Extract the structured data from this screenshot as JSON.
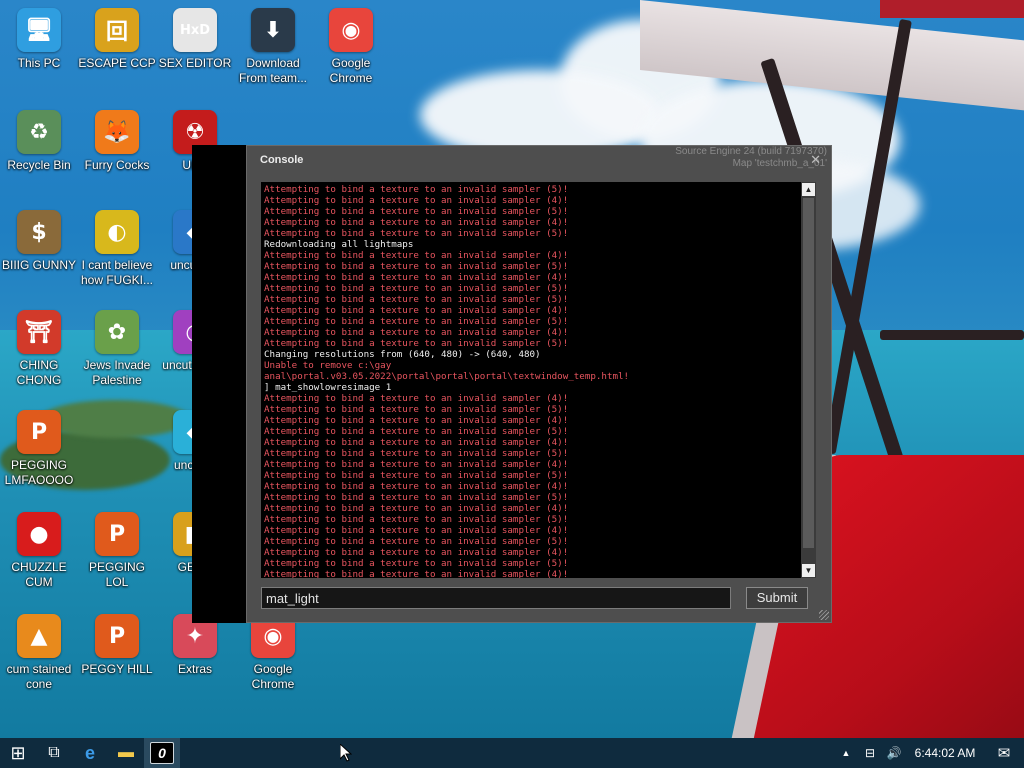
{
  "desktop": {
    "icons": [
      {
        "label": "This PC",
        "glyph": "🖥",
        "color": "#2f9ee0",
        "icon": "computer-icon"
      },
      {
        "label": "ESCAPE CCP",
        "glyph": "回",
        "color": "#d9a21c",
        "icon": "game-box-icon"
      },
      {
        "label": "SEX EDITOR",
        "glyph": "HxD",
        "color": "#e6e6e6",
        "icon": "hex-editor-icon"
      },
      {
        "label": "Download From team...",
        "glyph": "⬇",
        "color": "#2a3a4a",
        "icon": "download-icon"
      },
      {
        "label": "Google Chrome",
        "glyph": "◉",
        "color": "#e8453c",
        "icon": "chrome-icon"
      },
      {
        "label": "Recycle Bin",
        "glyph": "♻",
        "color": "#5a8f5a",
        "icon": "recycle-bin-icon"
      },
      {
        "label": "Furry Cocks",
        "glyph": "🦊",
        "color": "#f07a1a",
        "icon": "firefox-icon"
      },
      {
        "label": "UKR",
        "glyph": "☢",
        "color": "#c41c1c",
        "icon": "radiation-icon"
      },
      {
        "label": "BIIIG GUNNY",
        "glyph": "$",
        "color": "#8a6a3a",
        "icon": "money-bag-icon"
      },
      {
        "label": "I cant believe how FUGKI...",
        "glyph": "◐",
        "color": "#d8b81c",
        "icon": "app-icon"
      },
      {
        "label": "uncut bat",
        "glyph": "◆",
        "color": "#2a78c8",
        "icon": "app-icon"
      },
      {
        "label": "CHING CHONG",
        "glyph": "⛩",
        "color": "#d23a2a",
        "icon": "torii-icon"
      },
      {
        "label": "Jews Invade Palestine",
        "glyph": "✿",
        "color": "#6aa04a",
        "icon": "flower-icon"
      },
      {
        "label": "uncut delete",
        "glyph": "◔",
        "color": "#a040c0",
        "icon": "app-icon"
      },
      {
        "label": "PEGGING LMFAOOOO",
        "glyph": "P",
        "color": "#e05a1c",
        "icon": "p-logo-icon"
      },
      {
        "label": "uncut hi",
        "glyph": "◆",
        "color": "#2ab0d8",
        "icon": "gem-icon"
      },
      {
        "label": "CHUZZLE CUM",
        "glyph": "●",
        "color": "#d81c1c",
        "icon": "chuzzle-icon"
      },
      {
        "label": "PEGGING LOL",
        "glyph": "P",
        "color": "#e05a1c",
        "icon": "p-logo-icon"
      },
      {
        "label": "GENC",
        "glyph": "■",
        "color": "#d8a01c",
        "icon": "app-icon"
      },
      {
        "label": "cum stained cone",
        "glyph": "▲",
        "color": "#e88a1c",
        "icon": "cone-icon"
      },
      {
        "label": "PEGGY HILL",
        "glyph": "P",
        "color": "#e05a1c",
        "icon": "p-logo-icon"
      },
      {
        "label": "Extras",
        "glyph": "✦",
        "color": "#d84a5a",
        "icon": "extras-icon"
      },
      {
        "label": "Google Chrome",
        "glyph": "◉",
        "color": "#e8453c",
        "icon": "chrome-icon"
      }
    ]
  },
  "console": {
    "title": "Console",
    "engine_info": "Source Engine 24 (build 7197370)",
    "map_info": "Map 'testchmb_a_01'",
    "close_glyph": "✕",
    "log": [
      {
        "t": "Attempting to bind a texture to an invalid sampler (5)!",
        "k": "err"
      },
      {
        "t": "Attempting to bind a texture to an invalid sampler (4)!",
        "k": "err"
      },
      {
        "t": "Attempting to bind a texture to an invalid sampler (5)!",
        "k": "err"
      },
      {
        "t": "Attempting to bind a texture to an invalid sampler (4)!",
        "k": "err"
      },
      {
        "t": "Attempting to bind a texture to an invalid sampler (5)!",
        "k": "err"
      },
      {
        "t": "Redownloading all lightmaps",
        "k": "info"
      },
      {
        "t": "Attempting to bind a texture to an invalid sampler (4)!",
        "k": "err"
      },
      {
        "t": "Attempting to bind a texture to an invalid sampler (5)!",
        "k": "err"
      },
      {
        "t": "Attempting to bind a texture to an invalid sampler (4)!",
        "k": "err"
      },
      {
        "t": "Attempting to bind a texture to an invalid sampler (5)!",
        "k": "err"
      },
      {
        "t": "Attempting to bind a texture to an invalid sampler (5)!",
        "k": "err"
      },
      {
        "t": "Attempting to bind a texture to an invalid sampler (4)!",
        "k": "err"
      },
      {
        "t": "Attempting to bind a texture to an invalid sampler (5)!",
        "k": "err"
      },
      {
        "t": "Attempting to bind a texture to an invalid sampler (4)!",
        "k": "err"
      },
      {
        "t": "Attempting to bind a texture to an invalid sampler (5)!",
        "k": "err"
      },
      {
        "t": "Changing resolutions from (640, 480) -> (640, 480)",
        "k": "info"
      },
      {
        "t": "Unable to remove c:\\gay",
        "k": "err"
      },
      {
        "t": "anal\\portal.v03.05.2022\\portal\\portal\\portal\\textwindow_temp.html!",
        "k": "err"
      },
      {
        "t": "] mat_showlowresimage 1",
        "k": "info"
      },
      {
        "t": "Attempting to bind a texture to an invalid sampler (4)!",
        "k": "err"
      },
      {
        "t": "Attempting to bind a texture to an invalid sampler (5)!",
        "k": "err"
      },
      {
        "t": "Attempting to bind a texture to an invalid sampler (4)!",
        "k": "err"
      },
      {
        "t": "Attempting to bind a texture to an invalid sampler (5)!",
        "k": "err"
      },
      {
        "t": "Attempting to bind a texture to an invalid sampler (4)!",
        "k": "err"
      },
      {
        "t": "Attempting to bind a texture to an invalid sampler (5)!",
        "k": "err"
      },
      {
        "t": "Attempting to bind a texture to an invalid sampler (4)!",
        "k": "err"
      },
      {
        "t": "Attempting to bind a texture to an invalid sampler (5)!",
        "k": "err"
      },
      {
        "t": "Attempting to bind a texture to an invalid sampler (4)!",
        "k": "err"
      },
      {
        "t": "Attempting to bind a texture to an invalid sampler (5)!",
        "k": "err"
      },
      {
        "t": "Attempting to bind a texture to an invalid sampler (4)!",
        "k": "err"
      },
      {
        "t": "Attempting to bind a texture to an invalid sampler (5)!",
        "k": "err"
      },
      {
        "t": "Attempting to bind a texture to an invalid sampler (4)!",
        "k": "err"
      },
      {
        "t": "Attempting to bind a texture to an invalid sampler (5)!",
        "k": "err"
      },
      {
        "t": "Attempting to bind a texture to an invalid sampler (4)!",
        "k": "err"
      },
      {
        "t": "Attempting to bind a texture to an invalid sampler (5)!",
        "k": "err"
      },
      {
        "t": "Attempting to bind a texture to an invalid sampler (4)!",
        "k": "err"
      },
      {
        "t": "Attempting to bind a texture to an invalid sampler (5)!",
        "k": "err"
      },
      {
        "t": "Redownloading all lightmaps",
        "k": "info"
      }
    ],
    "input_value": "mat_light",
    "submit_label": "Submit",
    "scroll_up": "▲",
    "scroll_down": "▼"
  },
  "taskbar": {
    "start_glyph": "⊞",
    "taskview_glyph": "⧉",
    "edge_glyph": "e",
    "explorer_glyph": "▬",
    "console_app_glyph": "0",
    "tray_chevron": "▲",
    "network_glyph": "⊟",
    "volume_glyph": "🔊",
    "clock": "6:44:02 AM",
    "notification_glyph": "✉"
  }
}
